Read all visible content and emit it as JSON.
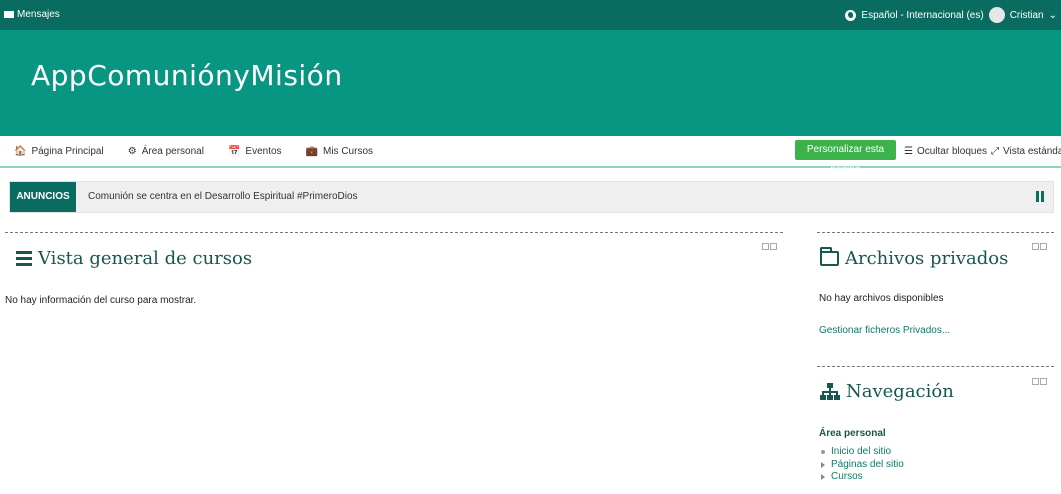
{
  "topbar": {
    "messages_label": "Mensajes",
    "language_label": "Español - Internacional (es)",
    "user_name": "Cristian",
    "user_menu_caret": "⌄"
  },
  "header": {
    "brand": "AppComuniónyMisión"
  },
  "navbar": {
    "items": [
      {
        "icon": "home-icon",
        "glyph": "🏠",
        "label": "Página Principal"
      },
      {
        "icon": "dashboard-icon",
        "glyph": "⚙",
        "label": "Área personal"
      },
      {
        "icon": "calendar-icon",
        "glyph": "📅",
        "label": "Eventos"
      },
      {
        "icon": "briefcase-icon",
        "glyph": "💼",
        "label": "Mis Cursos"
      }
    ],
    "customize_button": "Personalizar esta página",
    "hide_blocks": "Ocultar bloques",
    "standard_view": "Vista estándar"
  },
  "announcements": {
    "tag": "ANUNCIOS",
    "text": "Comunión se centra en el Desarrollo Espiritual #PrimeroDios"
  },
  "course_overview": {
    "title": "Vista general de cursos",
    "empty_text": "No hay información del curso para mostrar."
  },
  "private_files": {
    "title": "Archivos privados",
    "empty_text": "No hay archivos disponibles",
    "manage_link": "Gestionar ficheros Privados..."
  },
  "navigation": {
    "title": "Navegación",
    "section": "Área personal",
    "items": [
      {
        "label": "Inicio del sitio",
        "marker": "bullet"
      },
      {
        "label": "Páginas del sitio",
        "marker": "arrow"
      },
      {
        "label": "Cursos",
        "marker": "arrow"
      }
    ]
  },
  "colors": {
    "topbar": "#0a6c61",
    "header": "#069682",
    "accent_green": "#3cb24a",
    "heading": "#16584e"
  }
}
